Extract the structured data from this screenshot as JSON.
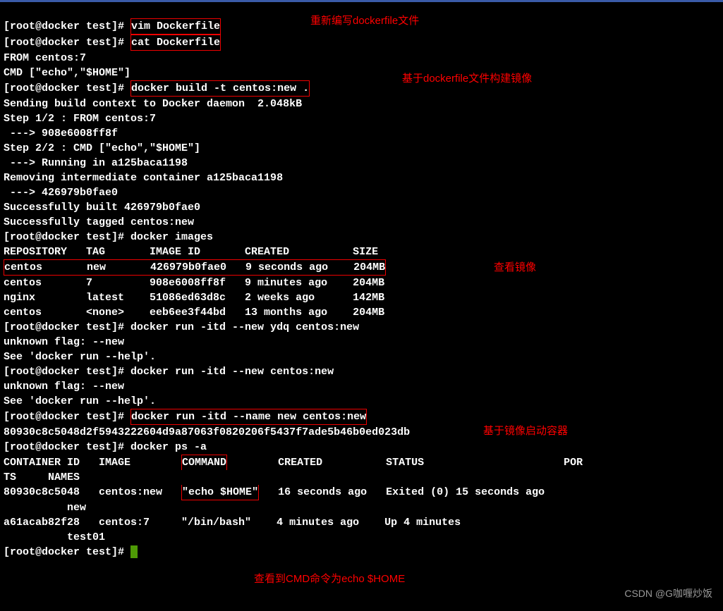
{
  "prompt": "[root@docker test]# ",
  "cmd1": "vim Dockerfile",
  "cmd2": "cat Dockerfile",
  "anno1": "重新编写dockerfile文件",
  "file1": "FROM centos:7",
  "file2": "CMD [\"echo\",\"$HOME\"]",
  "cmd3": "docker build -t centos:new .",
  "anno2": "基于dockerfile文件构建镜像",
  "b1": "Sending build context to Docker daemon  2.048kB",
  "b2": "Step 1/2 : FROM centos:7",
  "b3": " ---> 908e6008ff8f",
  "b4": "Step 2/2 : CMD [\"echo\",\"$HOME\"]",
  "b5": " ---> Running in a125baca1198",
  "b6": "Removing intermediate container a125baca1198",
  "b7": " ---> 426979b0fae0",
  "b8": "Successfully built 426979b0fae0",
  "b9": "Successfully tagged centos:new",
  "cmd4": "docker images",
  "imgh": "REPOSITORY   TAG       IMAGE ID       CREATED          SIZE",
  "img1": "centos       new       426979b0fae0   9 seconds ago    204MB",
  "anno3": "查看镜像",
  "img2": "centos       7         908e6008ff8f   9 minutes ago    204MB",
  "img3": "nginx        latest    51086ed63d8c   2 weeks ago      142MB",
  "img4": "centos       <none>    eeb6ee3f44bd   13 months ago    204MB",
  "cmd5": "docker run -itd --new ydq centos:new",
  "e1": "unknown flag: --new",
  "e2": "See 'docker run --help'.",
  "cmd6": "docker run -itd --new centos:new",
  "cmd7": "docker run -itd --name new centos:new",
  "anno4": "基于镜像启动容器",
  "cid": "80930c8c5048d2f5943222604d9a87063f0820206f5437f7ade5b46b0ed023db",
  "cmd8": "docker ps -a",
  "psh": "CONTAINER ID   IMAGE        COMMAND        CREATED          STATUS                      PORTS     NAMES",
  "psh_pre": "CONTAINER ID   IMAGE        ",
  "psh_cmd": "COMMAND",
  "psh_post": "        CREATED          STATUS                      PORTS     NAMES",
  "ps1_pre": "80930c8c5048   centos:new   ",
  "ps1_cmd": "\"echo $HOME\"",
  "ps1_post": "   16 seconds ago   Exited (0) 15 seconds ago             new",
  "ps2": "a61acab82f28   centos:7     \"/bin/bash\"    4 minutes ago    Up 4 minutes                          test01",
  "anno5": "查看到CMD命令为echo $HOME",
  "watermark": "CSDN @G咖喱炒饭"
}
